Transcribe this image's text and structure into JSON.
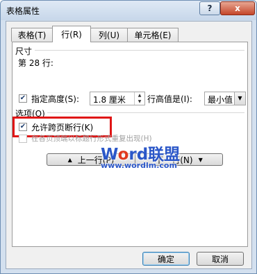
{
  "window": {
    "title": "表格属性"
  },
  "titlebar": {
    "help_glyph": "?",
    "close_glyph": "x"
  },
  "tabs": [
    {
      "label": "表格(T)"
    },
    {
      "label": "行(R)"
    },
    {
      "label": "列(U)"
    },
    {
      "label": "单元格(E)"
    }
  ],
  "active_tab": "行(R)",
  "size_section": {
    "heading": "尺寸",
    "row_label": "第 28 行:",
    "specify_height": {
      "label": "指定高度(S):",
      "checked": true
    },
    "height_value": "1.8 厘米",
    "row_height_is_label": "行高值是(I):",
    "row_height_is_value": "最小值"
  },
  "options_section": {
    "heading": "选项(O)",
    "allow_break": {
      "label": "允许跨页断行(K)",
      "checked": true
    },
    "repeat_header": {
      "label": "在各页顶端以标题行形式重复出现(H)",
      "checked": false,
      "disabled": true
    }
  },
  "navigation": {
    "prev_label": "上一行(P)",
    "next_label": "下一行(N)",
    "prev_glyph": "▲",
    "next_glyph": "▼"
  },
  "watermark": {
    "prefix": "W",
    "o_letter": "o",
    "rest": "rd联盟",
    "url": "www.wordlm.com"
  },
  "buttons": {
    "ok_label": "确定",
    "cancel_label": "取消"
  },
  "colors": {
    "highlight_border": "#e01515",
    "watermark_blue": "#2b57c8",
    "watermark_accent": "#e03a1e"
  }
}
